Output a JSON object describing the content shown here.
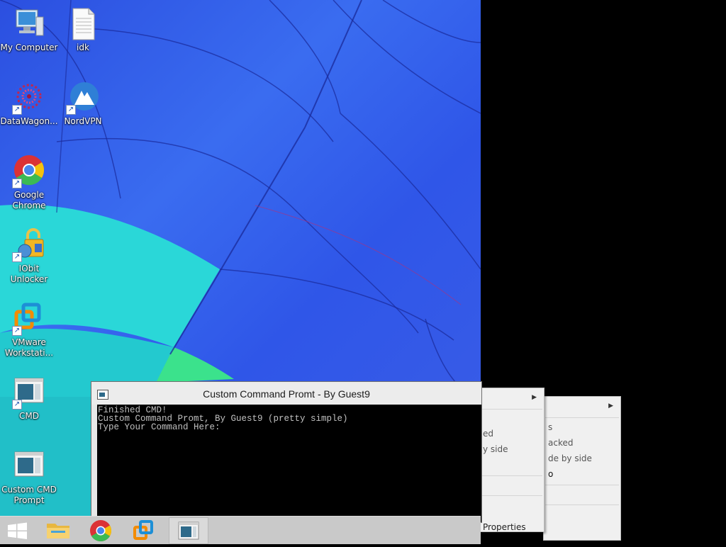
{
  "desktop": {
    "icons": [
      {
        "label": "My Computer",
        "icon": "computer-icon"
      },
      {
        "label": "idk",
        "icon": "text-file-icon"
      },
      {
        "label": "DataWagon...",
        "icon": "datawagon-icon"
      },
      {
        "label": "NordVPN",
        "icon": "nordvpn-icon"
      },
      {
        "label": "Google Chrome",
        "icon": "chrome-icon"
      },
      {
        "label": "IObit Unlocker",
        "icon": "unlocker-icon"
      },
      {
        "label": "VMware Workstati...",
        "icon": "vmware-icon"
      },
      {
        "label": "CMD",
        "icon": "cmd-app-icon"
      },
      {
        "label": "Custom CMD Prompt",
        "icon": "cmd-app-icon"
      }
    ]
  },
  "console_window": {
    "title": "Custom Command Promt - By Guest9",
    "lines": [
      "Finished CMD!",
      "Custom Command Promt, By Guest9 (pretty simple)",
      "Type Your Command Here:"
    ]
  },
  "context_menu_1": {
    "items": [
      "ed",
      "y side",
      "Properties"
    ]
  },
  "context_menu_2": {
    "items": [
      "s",
      "acked",
      "de by side",
      "o"
    ]
  },
  "taskbar": {
    "buttons": [
      {
        "name": "start",
        "icon": "windows-logo-icon"
      },
      {
        "name": "file-explorer",
        "icon": "folder-icon"
      },
      {
        "name": "chrome",
        "icon": "chrome-icon"
      },
      {
        "name": "vmware",
        "icon": "vmware-icon"
      },
      {
        "name": "custom-cmd",
        "icon": "cmd-app-icon",
        "active": true
      }
    ]
  },
  "colors": {
    "wallpaper_blue": "#2f56e8",
    "wallpaper_cyan": "#25d6d8",
    "console_bg": "#000000",
    "console_text": "#c0c0c0",
    "taskbar_bg": "#c9c9c9"
  }
}
